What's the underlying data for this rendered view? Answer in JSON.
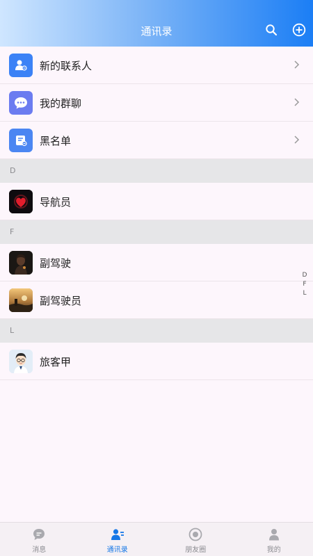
{
  "header": {
    "title": "通讯录",
    "search_icon": "search-icon",
    "add_icon": "plus-circle-icon"
  },
  "top_items": [
    {
      "label": "新的联系人",
      "icon": "new-contact-icon",
      "color": "#3b82f6"
    },
    {
      "label": "我的群聊",
      "icon": "group-chat-icon",
      "color": "#6b7cf0"
    },
    {
      "label": "黑名单",
      "icon": "blacklist-icon",
      "color": "#4b86f2"
    }
  ],
  "sections": [
    {
      "letter": "D",
      "contacts": [
        {
          "name": "导航员",
          "avatar": "heart-avatar"
        }
      ]
    },
    {
      "letter": "F",
      "contacts": [
        {
          "name": "副驾驶",
          "avatar": "dark-portrait-avatar"
        },
        {
          "name": "副驾驶员",
          "avatar": "sunset-avatar"
        }
      ]
    },
    {
      "letter": "L",
      "contacts": [
        {
          "name": "旅客甲",
          "avatar": "cartoon-boy-avatar"
        }
      ]
    }
  ],
  "index": [
    "D",
    "F",
    "L"
  ],
  "tabs": [
    {
      "label": "消息",
      "icon": "message-icon",
      "active": false
    },
    {
      "label": "通讯录",
      "icon": "contacts-icon",
      "active": true
    },
    {
      "label": "朋友圈",
      "icon": "moments-icon",
      "active": false
    },
    {
      "label": "我的",
      "icon": "profile-icon",
      "active": false
    }
  ],
  "colors": {
    "accent": "#1677e6",
    "header_end": "#1b7ef5",
    "section_bg": "#e6e6e8"
  }
}
